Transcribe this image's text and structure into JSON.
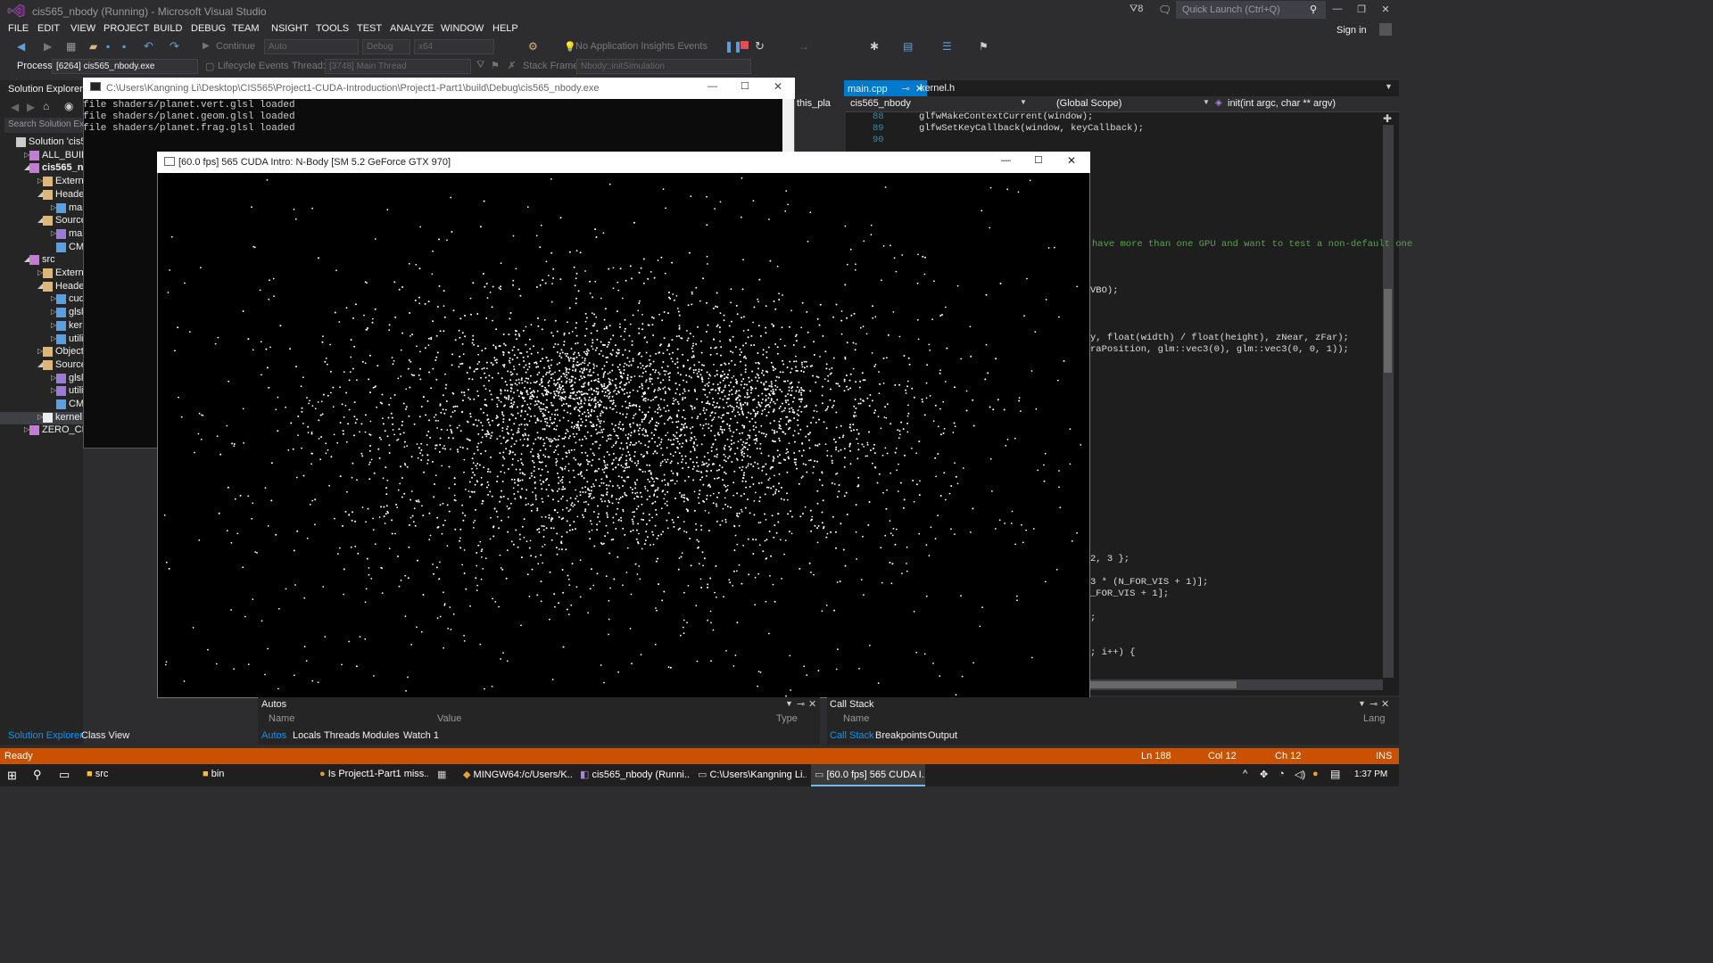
{
  "title_bar": {
    "title": "cis565_nbody (Running) - Microsoft Visual Studio",
    "filter_count": "8",
    "quick_launch_placeholder": "Quick Launch (Ctrl+Q)",
    "sign_in": "Sign in"
  },
  "menu": [
    "FILE",
    "EDIT",
    "VIEW",
    "PROJECT",
    "BUILD",
    "DEBUG",
    "TEAM",
    "NSIGHT",
    "TOOLS",
    "TEST",
    "ANALYZE",
    "WINDOW",
    "HELP"
  ],
  "toolbar": {
    "continue_label": "Continue",
    "auto_combo": "Auto",
    "config_combo": "Debug",
    "platform_combo": "x64",
    "insights_label": "No Application Insights Events",
    "process_label": "Process:",
    "process_value": "[6264] cis565_nbody.exe",
    "lifecycle_label": "Lifecycle Events",
    "thread_label": "Thread:",
    "thread_value": "[3748] Main Thread",
    "stackframe_label": "Stack Frame:",
    "stackframe_value": "Nbody::initSimulation"
  },
  "solution_explorer": {
    "title": "Solution Explorer",
    "search_placeholder": "Search Solution Exp",
    "items": [
      {
        "label": "Solution 'cis56",
        "indent": 0,
        "arrow": "",
        "icon": "solution-icon"
      },
      {
        "label": "ALL_BUILD",
        "indent": 1,
        "arrow": "▷",
        "icon": "project-icon"
      },
      {
        "label": "cis565_nb",
        "indent": 1,
        "arrow": "◢",
        "icon": "project-icon",
        "bold": true
      },
      {
        "label": "Externa",
        "indent": 2,
        "arrow": "▷",
        "icon": "folder-icon"
      },
      {
        "label": "Header",
        "indent": 2,
        "arrow": "◢",
        "icon": "folder-icon"
      },
      {
        "label": "mai",
        "indent": 3,
        "arrow": "▷",
        "icon": "file-icon"
      },
      {
        "label": "Source",
        "indent": 2,
        "arrow": "◢",
        "icon": "folder-icon"
      },
      {
        "label": "mai",
        "indent": 3,
        "arrow": "▷",
        "icon": "cpp-file-icon"
      },
      {
        "label": "CMake",
        "indent": 3,
        "arrow": "",
        "icon": "file-icon"
      },
      {
        "label": "src",
        "indent": 1,
        "arrow": "◢",
        "icon": "project-icon"
      },
      {
        "label": "Externa",
        "indent": 2,
        "arrow": "▷",
        "icon": "folder-icon"
      },
      {
        "label": "Header",
        "indent": 2,
        "arrow": "◢",
        "icon": "folder-icon"
      },
      {
        "label": "cud",
        "indent": 3,
        "arrow": "▷",
        "icon": "file-icon"
      },
      {
        "label": "glsl",
        "indent": 3,
        "arrow": "▷",
        "icon": "file-icon"
      },
      {
        "label": "kerr",
        "indent": 3,
        "arrow": "▷",
        "icon": "file-icon"
      },
      {
        "label": "utili",
        "indent": 3,
        "arrow": "▷",
        "icon": "file-icon"
      },
      {
        "label": "Object",
        "indent": 2,
        "arrow": "▷",
        "icon": "folder-icon"
      },
      {
        "label": "Source",
        "indent": 2,
        "arrow": "◢",
        "icon": "folder-icon"
      },
      {
        "label": "glsl",
        "indent": 3,
        "arrow": "▷",
        "icon": "cpp-file-icon"
      },
      {
        "label": "utili",
        "indent": 3,
        "arrow": "▷",
        "icon": "cpp-file-icon"
      },
      {
        "label": "CMake",
        "indent": 3,
        "arrow": "",
        "icon": "file-icon"
      },
      {
        "label": "kernel.c",
        "indent": 2,
        "arrow": "▷",
        "icon": "cuda-file-icon"
      },
      {
        "label": "ZERO_CHE",
        "indent": 1,
        "arrow": "▷",
        "icon": "project-icon"
      }
    ],
    "bottom_tabs": [
      "Solution Explorer",
      "Class View"
    ]
  },
  "editor": {
    "tabs": [
      "main.cpp",
      "kernel.h"
    ],
    "partial_tab": "this_pla",
    "nav_project": "cis565_nbody",
    "nav_scope": "(Global Scope)",
    "nav_function": "init(int argc, char ** argv)",
    "line_numbers": [
      "88",
      "89",
      "90"
    ],
    "lines": [
      "glfwMakeContextCurrent(window);",
      "glfwSetKeyCallback(window, keyCallback);",
      ""
    ],
    "fragments": [
      "have more than one GPU and want to test a non-default one",
      "VBO);",
      "y, float(width) / float(height), zNear, zFar);",
      "raPosition, glm::vec3(0), glm::vec3(0, 0, 1));",
      "2, 3 };",
      "3 * (N_FOR_VIS + 1)];",
      "_FOR_VIS + 1];",
      ";",
      "; i++) {"
    ]
  },
  "console": {
    "title": "C:\\Users\\Kangning Li\\Desktop\\CIS565\\Project1-CUDA-Introduction\\Project1-Part1\\build\\Debug\\cis565_nbody.exe",
    "lines": [
      "file shaders/planet.vert.glsl loaded",
      "file shaders/planet.geom.glsl loaded",
      "file shaders/planet.frag.glsl loaded"
    ]
  },
  "nbody_window": {
    "title": "[60.0 fps] 565 CUDA Intro: N-Body [SM 5.2 GeForce GTX 970]"
  },
  "autos": {
    "title": "Autos",
    "columns": [
      "Name",
      "Value",
      "Type"
    ],
    "tabs": [
      "Autos",
      "Locals",
      "Threads",
      "Modules",
      "Watch 1"
    ]
  },
  "call_stack": {
    "title": "Call Stack",
    "columns": [
      "Name",
      "Lang"
    ],
    "tabs": [
      "Call Stack",
      "Breakpoints",
      "Output"
    ]
  },
  "status_bar": {
    "status": "Ready",
    "line": "Ln 188",
    "col": "Col 12",
    "ch": "Ch 12",
    "mode": "INS"
  },
  "taskbar": {
    "items": [
      {
        "label": "src",
        "icon": "folder-icon"
      },
      {
        "label": "bin",
        "icon": "folder-icon"
      },
      {
        "label": "Is Project1-Part1 miss...",
        "icon": "chrome-icon"
      },
      {
        "label": "",
        "icon": "calculator-icon"
      },
      {
        "label": "MINGW64:/c/Users/K...",
        "icon": "git-icon"
      },
      {
        "label": "cis565_nbody (Runni...",
        "icon": "vs-icon"
      },
      {
        "label": "C:\\Users\\Kangning Li...",
        "icon": "console-icon"
      },
      {
        "label": "[60.0 fps] 565 CUDA I...",
        "icon": "app-window-icon",
        "active": true
      }
    ],
    "clock": "1:37 PM"
  },
  "colors": {
    "vs_bg": "#2d2d30",
    "editor_bg": "#1e1e1e",
    "accent": "#007acc",
    "status_bar_debug": "#ca5100",
    "particle": "#ffffff"
  }
}
